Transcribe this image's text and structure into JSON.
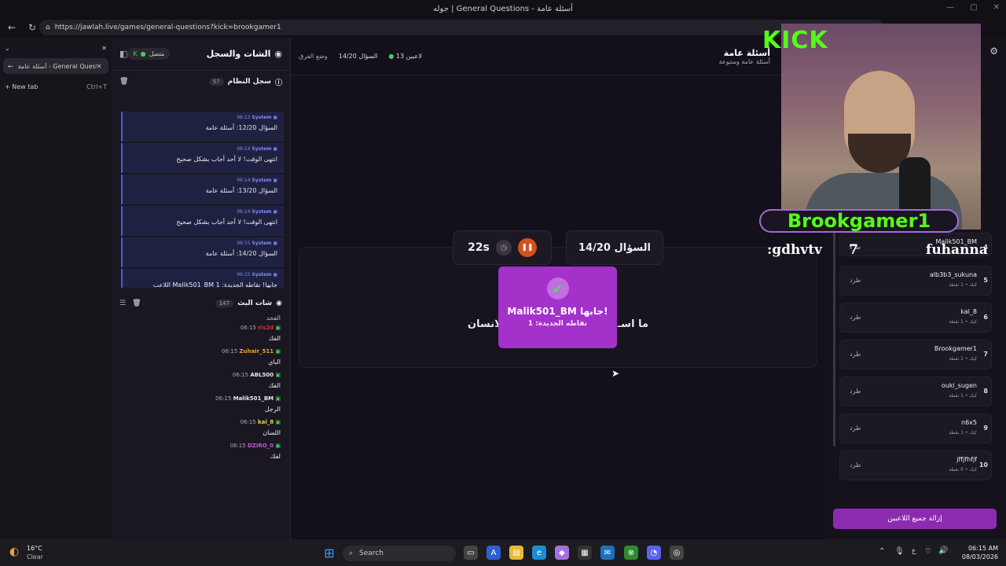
{
  "window": {
    "title": "جوله | General Questions - أسئلة عامة",
    "url": "https://jawlah.live/games/general-questions?kick=brookgamer1"
  },
  "tabs": [
    {
      "label": "أسئلة عامة - General Questions"
    },
    {
      "label": "New tab",
      "shortcut": "Ctrl+T"
    }
  ],
  "chat": {
    "title": "الشات والسجل",
    "status": "متصل",
    "system_log": {
      "label": "سجل النظام",
      "count": "57",
      "entries": [
        {
          "time": "06:13",
          "from": "System",
          "text": "السؤال 12/20: أسئلة عامة"
        },
        {
          "time": "06:14",
          "from": "System",
          "text": "انتهى الوقت! لا أحد أجاب بشكل صحيح"
        },
        {
          "time": "06:14",
          "from": "System",
          "text": "السؤال 13/20: أسئلة عامة"
        },
        {
          "time": "06:14",
          "from": "System",
          "text": "انتهى الوقت! لا أحد أجاب بشكل صحيح"
        },
        {
          "time": "06:15",
          "from": "System",
          "text": "السؤال 14/20: أسئلة عامة"
        },
        {
          "time": "06:15",
          "from": "System",
          "text": "اللاعب Malik501_BM جابها! نقاطه الجديدة: 1"
        }
      ]
    },
    "live_chat": {
      "label": "شات البث",
      "count": "147",
      "top_text": "الفحد",
      "messages": [
        {
          "time": "06:15",
          "user": "ris2d",
          "color": "#d0333c",
          "text": "الفك"
        },
        {
          "time": "06:15",
          "user": "Zuhair_511",
          "color": "#e4a33b",
          "text": "الباي"
        },
        {
          "time": "06:15",
          "user": "ABL500",
          "color": "#e8e8e8",
          "text": "الفك"
        },
        {
          "time": "06:15",
          "user": "Malik501_BM",
          "color": "#e8e8e8",
          "text": "الرجل"
        },
        {
          "time": "06:15",
          "user": "kai_8",
          "color": "#e8d33b",
          "text": "اللسان"
        },
        {
          "time": "06:15",
          "user": "DZIRO_0",
          "color": "#c05ad8",
          "text": "لفك"
        }
      ]
    }
  },
  "game": {
    "players_count": "13 لاعبين",
    "question": "السؤال 14/20",
    "mode": "وضع الفرق",
    "heading": "أسئلة عامة",
    "subheading": "أسئلة عامة ومتنوعة",
    "timer": "22s",
    "question_label": "السؤال 14/20",
    "question_text_left": "ما اسـ",
    "question_text_right": "لانسان",
    "popup_title": "Malik501_BM جابها!",
    "popup_sub": "نقاطه الجديدة: 1"
  },
  "players": [
    {
      "rank": "4",
      "name": "Malik501_BM",
      "sub": "",
      "kick": "طرد"
    },
    {
      "rank": "5",
      "name": "alb3b3_sukuna",
      "sub": "كيك • 1 نقطة",
      "kick": "طرد"
    },
    {
      "rank": "6",
      "name": "kal_8",
      "sub": "كيك • 1 نقطة",
      "kick": "طرد"
    },
    {
      "rank": "7",
      "name": "Brookgamer1",
      "sub": "كيك • 1 نقطة",
      "kick": "طرد"
    },
    {
      "rank": "8",
      "name": "ouki_sugen",
      "sub": "كيك • 1 نقطة",
      "kick": "طرد"
    },
    {
      "rank": "9",
      "name": "n6x5",
      "sub": "كيك • 1 نقطة",
      "kick": "طرد"
    },
    {
      "rank": "10",
      "name": "jffjfhfjf",
      "sub": "كيك • 0 نقطة",
      "kick": "طرد"
    }
  ],
  "remove_all": "إزالة جميع اللاعبين",
  "overlay": {
    "kick_logo": "KICK",
    "streamer": "Brookgamer1",
    "left_text": ":gdhvtv",
    "mid_num": "7",
    "right_text": "fuhanna"
  },
  "taskbar": {
    "weather_temp": "16°C",
    "weather_desc": "Clear",
    "search": "Search",
    "time": "06:15 AM",
    "date": "08/03/2026",
    "lang": "ع"
  }
}
